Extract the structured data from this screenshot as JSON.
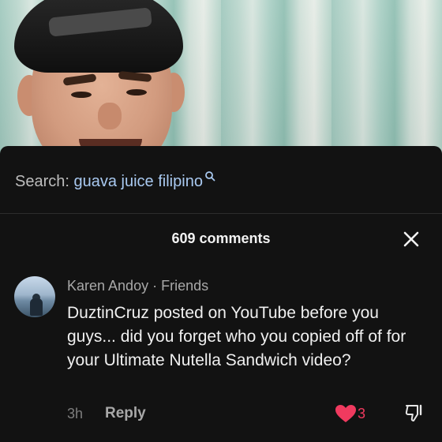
{
  "search": {
    "prefix": "Search:",
    "query": "guava juice filipino"
  },
  "comments": {
    "count_label": "609 comments"
  },
  "comment": {
    "author": "Karen Andoy",
    "relation": "Friends",
    "separator": "·",
    "text": "DuztinCruz posted on YouTube before you guys... did you forget who you copied off of for your Ultimate Nutella Sandwich video?",
    "time": "3h",
    "reply_label": "Reply",
    "like_count": "3"
  },
  "colors": {
    "background": "#121212",
    "query_link": "#a9c9f0",
    "like_red": "#f03a5f"
  },
  "icons": {
    "search": "search-icon",
    "close": "close-icon",
    "like": "heart-icon",
    "dislike": "thumbs-down-icon"
  }
}
